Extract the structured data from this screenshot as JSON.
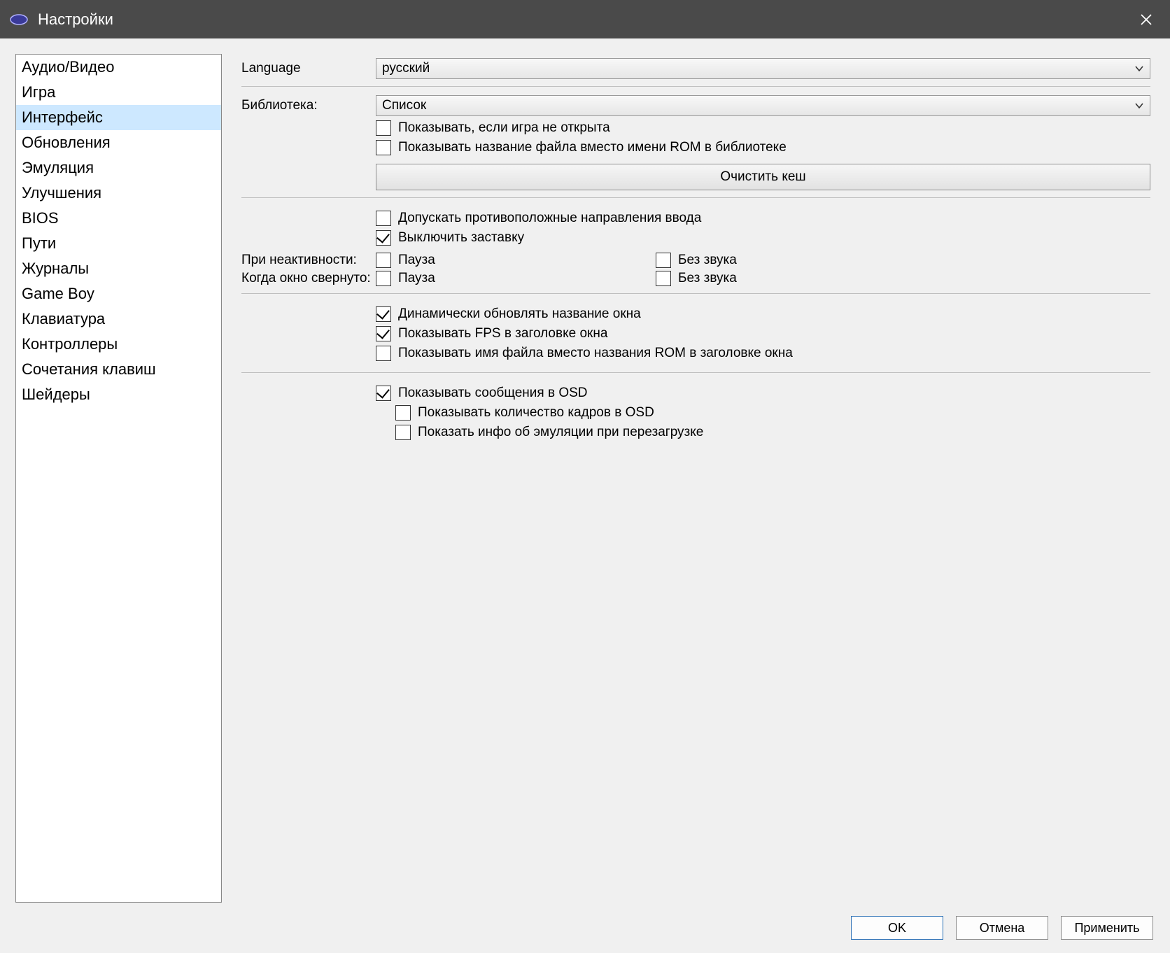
{
  "window": {
    "title": "Настройки"
  },
  "sidebar": {
    "selected_index": 2,
    "items": [
      "Аудио/Видео",
      "Игра",
      "Интерфейс",
      "Обновления",
      "Эмуляция",
      "Улучшения",
      "BIOS",
      "Пути",
      "Журналы",
      "Game Boy",
      "Клавиатура",
      "Контроллеры",
      "Сочетания клавиш",
      "Шейдеры"
    ]
  },
  "main": {
    "language": {
      "label": "Language",
      "value": "русский"
    },
    "library": {
      "label": "Библиотека:",
      "value": "Список",
      "show_if_no_game": {
        "label": "Показывать, если игра не открыта",
        "checked": false
      },
      "show_filename_instead_rom": {
        "label": "Показывать название файла вместо имени ROM в библиотеке",
        "checked": false
      },
      "clear_cache_btn": "Очистить кеш"
    },
    "opposing_input": {
      "label": "Допускать противоположные направления ввода",
      "checked": false
    },
    "disable_screensaver": {
      "label": "Выключить заставку",
      "checked": true
    },
    "on_inactive": {
      "label": "При неактивности:",
      "pause": {
        "label": "Пауза",
        "checked": false
      },
      "mute": {
        "label": "Без звука",
        "checked": false
      }
    },
    "on_minimized": {
      "label": "Когда окно свернуто:",
      "pause": {
        "label": "Пауза",
        "checked": false
      },
      "mute": {
        "label": "Без звука",
        "checked": false
      }
    },
    "dynamic_title": {
      "label": "Динамически обновлять название окна",
      "checked": true
    },
    "show_fps_title": {
      "label": "Показывать FPS в заголовке окна",
      "checked": true
    },
    "show_filename_title": {
      "label": "Показывать имя файла вместо названия ROM в заголовке окна",
      "checked": false
    },
    "osd_messages": {
      "label": "Показывать сообщения в OSD",
      "checked": true,
      "frame_count": {
        "label": "Показывать количество кадров в OSD",
        "checked": false
      },
      "emu_info_reset": {
        "label": "Показать инфо об эмуляции при перезагрузке",
        "checked": false
      }
    }
  },
  "buttons": {
    "ok": "OK",
    "cancel": "Отмена",
    "apply": "Применить"
  }
}
